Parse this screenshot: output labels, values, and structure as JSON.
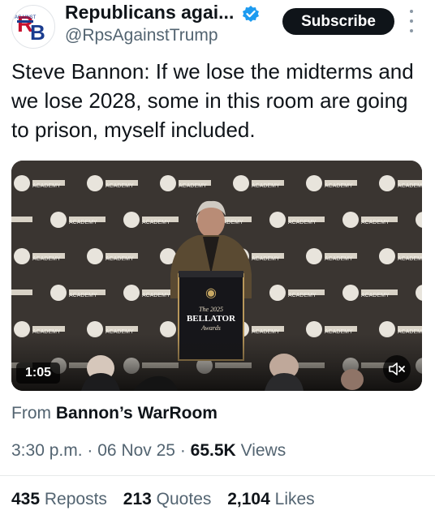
{
  "author": {
    "name": "Republicans agai...",
    "handle": "@RpsAgainstTrump",
    "avatar_text": "RB",
    "verified_color": "#1d9bf0"
  },
  "subscribe_label": "Subscribe",
  "tweet_text": "Steve Bannon: If we lose the midterms and we lose 2028, some in this room are going to prison, myself included.",
  "video": {
    "duration": "1:05",
    "backdrop_label": "ACADEMY",
    "podium_line1": "The 2025",
    "podium_line2": "BELLATOR",
    "podium_line3": "Awards"
  },
  "source": {
    "prefix": "From",
    "name": "Bannon’s WarRoom"
  },
  "meta": {
    "time": "3:30 p.m.",
    "date": "06 Nov 25",
    "views_count": "65.5K",
    "views_label": "Views",
    "separator": "·"
  },
  "stats": {
    "reposts_count": "435",
    "reposts_label": "Reposts",
    "quotes_count": "213",
    "quotes_label": "Quotes",
    "likes_count": "2,104",
    "likes_label": "Likes"
  }
}
